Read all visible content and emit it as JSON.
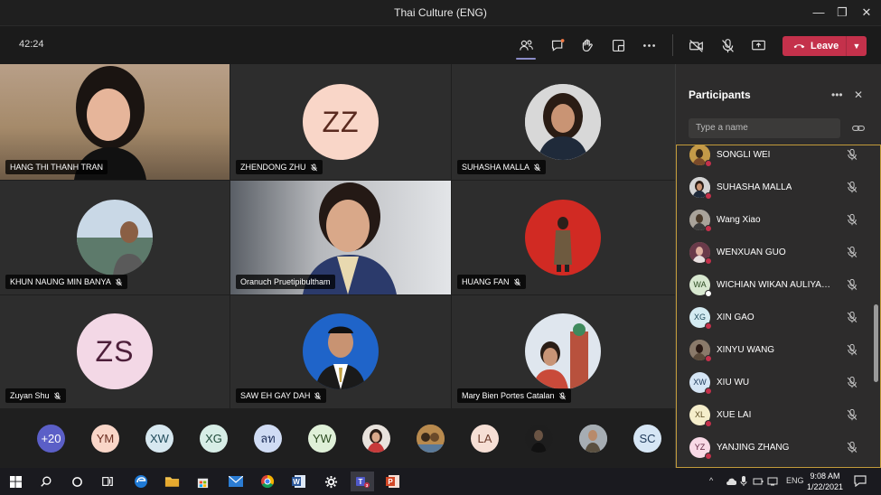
{
  "window": {
    "title": "Thai Culture (ENG)"
  },
  "meeting": {
    "timer": "42:24",
    "leave_label": "Leave"
  },
  "tiles": [
    {
      "name": "HANG THI THANH TRAN",
      "kind": "video"
    },
    {
      "name": "ZHENDONG ZHU",
      "kind": "initials",
      "initials": "ZZ",
      "color": "#f9d6c8"
    },
    {
      "name": "SUHASHA MALLA",
      "kind": "photo"
    },
    {
      "name": "KHUN NAUNG MIN BANYA",
      "kind": "photo"
    },
    {
      "name": "Oranuch Pruetipibultham",
      "kind": "video"
    },
    {
      "name": "HUANG FAN",
      "kind": "photo"
    },
    {
      "name": "Zuyan Shu",
      "kind": "initials",
      "initials": "ZS",
      "color": "#f3d8e6"
    },
    {
      "name": "SAW EH GAY DAH",
      "kind": "photo"
    },
    {
      "name": "Mary Bien Portes Catalan",
      "kind": "photo"
    }
  ],
  "strip": [
    {
      "label": "+20",
      "color": "#5b5fc7",
      "text_color": "#ffffff"
    },
    {
      "label": "YM",
      "color": "#f9d6c8"
    },
    {
      "label": "XW",
      "color": "#d7e8f0"
    },
    {
      "label": "XG",
      "color": "#d7ede6"
    },
    {
      "label": "ลท",
      "color": "#d0dcf4"
    },
    {
      "label": "YW",
      "color": "#dff0d8"
    },
    {
      "label": "",
      "photo": true
    },
    {
      "label": "",
      "photo": true
    },
    {
      "label": "LA",
      "color": "#f6dfd5"
    },
    {
      "label": "",
      "photo": true
    },
    {
      "label": "",
      "photo": true
    },
    {
      "label": "SC",
      "color": "#d6e6f5"
    }
  ],
  "participants_panel": {
    "title": "Participants",
    "search_placeholder": "Type a name",
    "participants": [
      {
        "name": "SONGLI WEI",
        "photo": true
      },
      {
        "name": "SUHASHA MALLA",
        "photo": true
      },
      {
        "name": "Wang Xiao",
        "photo": true
      },
      {
        "name": "WENXUAN GUO",
        "photo": true
      },
      {
        "name": "WICHIAN WIKAN AULIYANTA...",
        "initials": "WA",
        "color": "#d8e8d0",
        "dot": "white"
      },
      {
        "name": "XIN GAO",
        "initials": "XG",
        "color": "#d4ebf2"
      },
      {
        "name": "XINYU WANG",
        "photo": true
      },
      {
        "name": "XIU WU",
        "initials": "XW",
        "color": "#d5e5f5"
      },
      {
        "name": "XUE LAI",
        "initials": "XL",
        "color": "#f5eecb"
      },
      {
        "name": "YANJING ZHANG",
        "initials": "YZ",
        "color": "#f8d9e6"
      }
    ]
  },
  "taskbar": {
    "language": "ENG",
    "time": "9:08 AM",
    "date": "1/22/2021"
  }
}
